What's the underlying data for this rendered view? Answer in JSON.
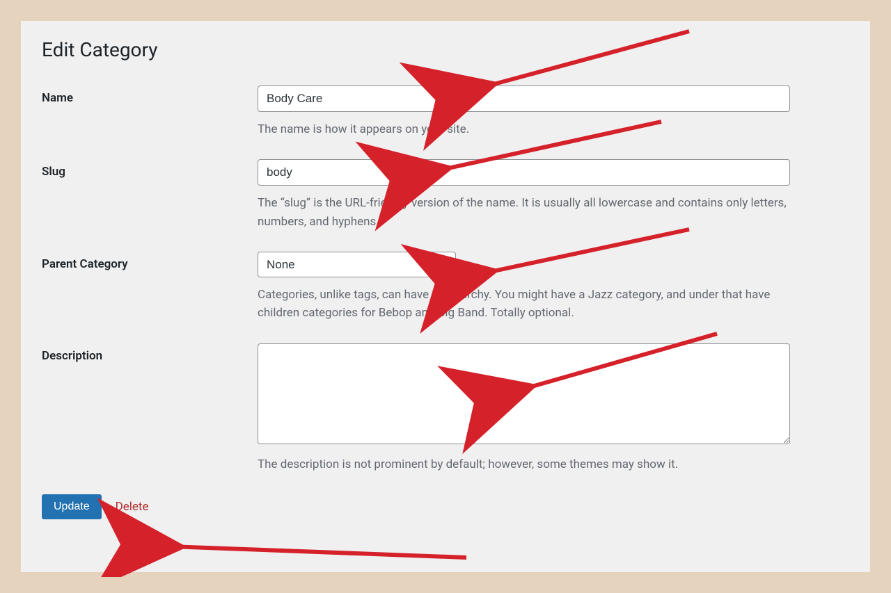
{
  "page": {
    "title": "Edit Category"
  },
  "fields": {
    "name": {
      "label": "Name",
      "value": "Body Care",
      "help": "The name is how it appears on your site."
    },
    "slug": {
      "label": "Slug",
      "value": "body",
      "help": "The “slug” is the URL-friendly version of the name. It is usually all lowercase and contains only letters, numbers, and hyphens."
    },
    "parent": {
      "label": "Parent Category",
      "selected": "None",
      "help": "Categories, unlike tags, can have a hierarchy. You might have a Jazz category, and under that have children categories for Bebop and Big Band. Totally optional."
    },
    "description": {
      "label": "Description",
      "value": "",
      "help": "The description is not prominent by default; however, some themes may show it."
    }
  },
  "actions": {
    "update": "Update",
    "delete": "Delete"
  }
}
